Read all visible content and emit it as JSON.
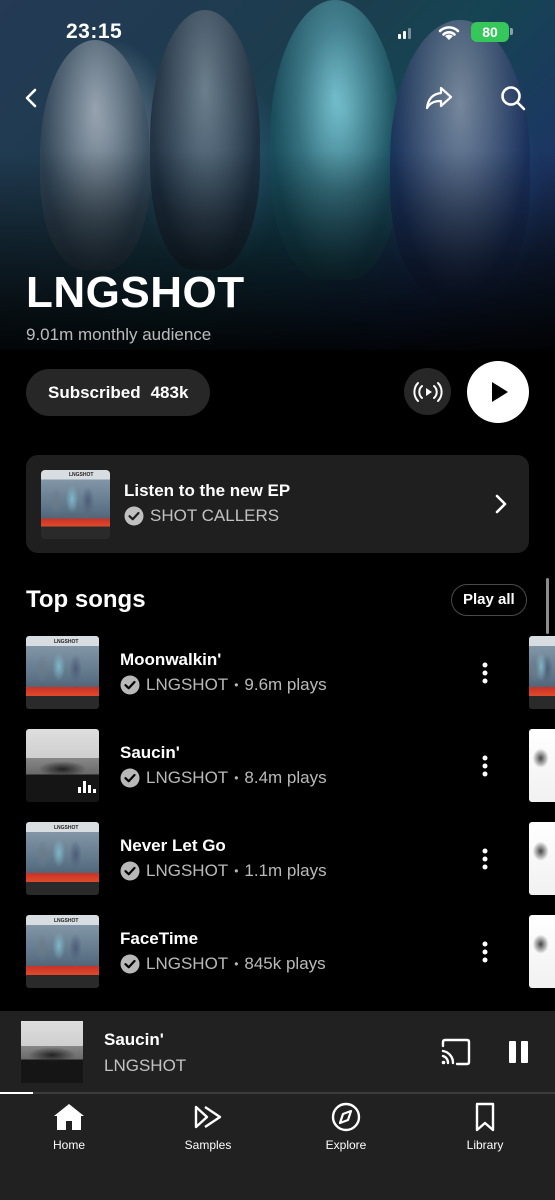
{
  "status_bar": {
    "time": "23:15",
    "battery": "80"
  },
  "artist": {
    "name": "LNGSHOT",
    "audience": "9.01m monthly audience"
  },
  "actions": {
    "subscribe_label": "Subscribed",
    "subscriber_count": "483k"
  },
  "promo": {
    "title": "Listen to the new EP",
    "subtitle": "SHOT CALLERS"
  },
  "top_songs": {
    "title": "Top songs",
    "play_all_label": "Play all",
    "songs": [
      {
        "title": "Moonwalkin'",
        "artist": "LNGSHOT",
        "plays": "9.6m plays"
      },
      {
        "title": "Saucin'",
        "artist": "LNGSHOT",
        "plays": "8.4m plays"
      },
      {
        "title": "Never Let Go",
        "artist": "LNGSHOT",
        "plays": "1.1m plays"
      },
      {
        "title": "FaceTime",
        "artist": "LNGSHOT",
        "plays": "845k plays"
      }
    ]
  },
  "now_playing": {
    "title": "Saucin'",
    "artist": "LNGSHOT",
    "progress": 0.06
  },
  "bottom_nav": {
    "items": [
      {
        "label": "Home",
        "icon": "home-icon"
      },
      {
        "label": "Samples",
        "icon": "samples-icon"
      },
      {
        "label": "Explore",
        "icon": "compass-icon"
      },
      {
        "label": "Library",
        "icon": "bookmark-icon"
      }
    ]
  },
  "colors": {
    "background": "#000000",
    "card": "#1f1f1f",
    "battery": "#35c759"
  }
}
